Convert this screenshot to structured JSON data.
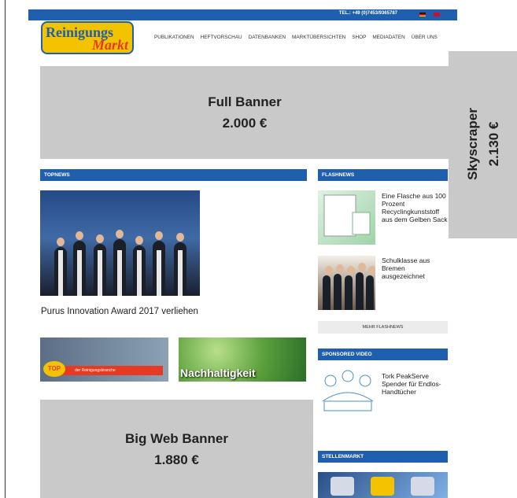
{
  "topbar": {
    "phone": "TEL.: +49 (0)7453/9365787"
  },
  "logo": {
    "line1": "Reinigungs",
    "line2": "Markt"
  },
  "nav": [
    "PUBLIKATIONEN",
    "HEFTVORSCHAU",
    "DATENBANKEN",
    "MARKTÜBERSICHTEN",
    "SHOP",
    "MEDIADATEN",
    "ÜBER UNS"
  ],
  "ads": {
    "full_banner": {
      "label": "Full Banner",
      "price": "2.000 €"
    },
    "skyscraper": {
      "label": "Skyscraper",
      "price": "2.130 €"
    },
    "big_web_banner": {
      "label": "Big Web Banner",
      "price": "1.880 €"
    }
  },
  "topnews": {
    "title": "TOPNEWS",
    "headline": "Purus Innovation Award 2017 verliehen"
  },
  "teasers": {
    "top_partner": "TOP Partner",
    "top_partner_strip": "der Reinigungsbranche",
    "nachhaltigkeit": "Nachhaltigkeit"
  },
  "flashnews": {
    "title": "FLASHNEWS",
    "items": [
      {
        "title": "Eine Flasche aus 100 Prozent Recyclingkunststoff aus dem Gelben Sack"
      },
      {
        "title": "Schulklasse aus Bremen ausgezeichnet"
      }
    ],
    "more": "MEHR FLASHNEWS"
  },
  "sponsored": {
    "title": "SPONSORED VIDEO",
    "video_title": "Tork PeakServe Spender für Endlos-Handtücher"
  },
  "stellenmarkt": {
    "title": "STELLENMARKT"
  }
}
